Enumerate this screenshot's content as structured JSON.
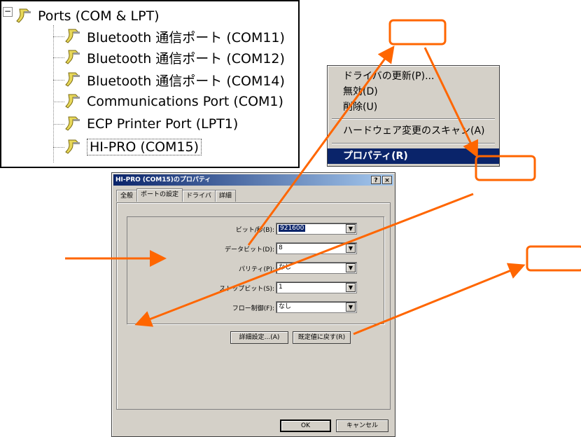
{
  "device_tree": {
    "expander_symbol": "−",
    "category": "Ports (COM & LPT)",
    "items": [
      {
        "label": "Bluetooth 通信ポート (COM11)"
      },
      {
        "label": "Bluetooth 通信ポート (COM12)"
      },
      {
        "label": "Bluetooth 通信ポート (COM14)"
      },
      {
        "label": "Communications Port (COM1)"
      },
      {
        "label": "ECP Printer Port (LPT1)"
      },
      {
        "label": "HI-PRO (COM15)"
      }
    ],
    "icon": "serial-port-icon"
  },
  "context_menu": {
    "items": [
      {
        "label": "ドライバの更新(P)..."
      },
      {
        "label": "無効(D)"
      },
      {
        "label": "削除(U)"
      },
      {
        "label": "ハードウェア変更のスキャン(A)"
      },
      {
        "label": "プロパティ(R)"
      }
    ],
    "highlighted": "プロパティ(R)"
  },
  "dialog": {
    "title": "HI-PRO (COM15)のプロパティ",
    "help_button": "?",
    "close_button": "×",
    "tabs": [
      {
        "label": "全般"
      },
      {
        "label": "ポートの設定"
      },
      {
        "label": "ドライバ"
      },
      {
        "label": "詳細"
      }
    ],
    "active_tab": "ポートの設定",
    "fields": [
      {
        "label": "ビット/秒(B):",
        "value": "921600"
      },
      {
        "label": "データビット(D):",
        "value": "8"
      },
      {
        "label": "パリティ(P):",
        "value": "なし"
      },
      {
        "label": "ストップビット(S):",
        "value": "1"
      },
      {
        "label": "フロー制御(F):",
        "value": "なし"
      }
    ],
    "advanced_button": "詳細設定...(A)",
    "restore_defaults_button": "既定値に戻す(R)",
    "ok_button": "OK",
    "cancel_button": "キャンセル"
  },
  "annotation": {
    "arrow_color": "#ff6600",
    "box_color": "#ff6600"
  }
}
